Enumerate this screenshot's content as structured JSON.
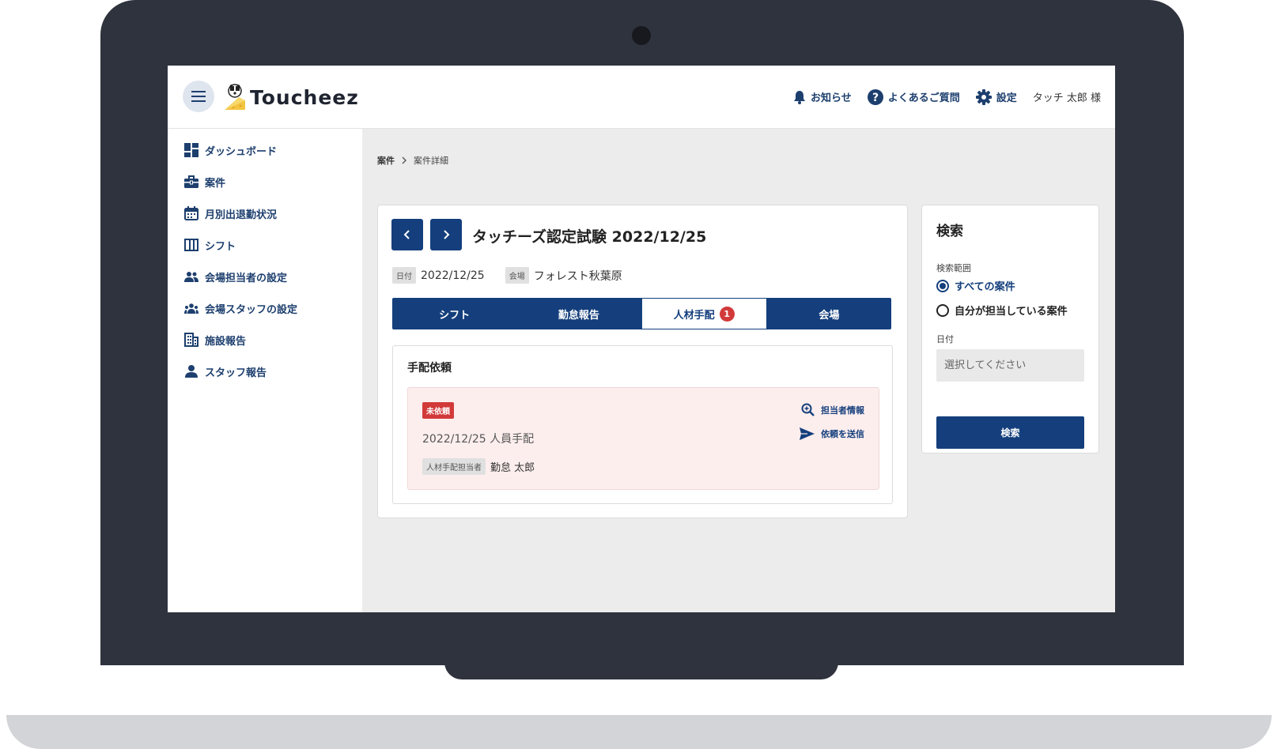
{
  "app": {
    "logo_text": "Toucheez"
  },
  "header": {
    "notice_label": "お知らせ",
    "faq_label": "よくあるご質問",
    "settings_label": "設定",
    "user_label": "タッチ 太郎 様"
  },
  "sidebar": {
    "items": [
      {
        "label": "ダッシュボード",
        "icon": "dashboard-icon"
      },
      {
        "label": "案件",
        "icon": "briefcase-icon"
      },
      {
        "label": "月別出退勤状況",
        "icon": "calendar-icon"
      },
      {
        "label": "シフト",
        "icon": "columns-icon"
      },
      {
        "label": "会場担当者の設定",
        "icon": "people-icon"
      },
      {
        "label": "会場スタッフの設定",
        "icon": "group-icon"
      },
      {
        "label": "施設報告",
        "icon": "building-icon"
      },
      {
        "label": "スタッフ報告",
        "icon": "person-icon"
      }
    ]
  },
  "breadcrumb": {
    "root": "案件",
    "current": "案件詳細"
  },
  "case": {
    "title": "タッチーズ認定試験 2022/12/25",
    "date_tag": "日付",
    "date": "2022/12/25",
    "venue_tag": "会場",
    "venue": "フォレスト秋葉原"
  },
  "tabs": {
    "shift": "シフト",
    "attendance": "勤怠報告",
    "staffing": "人材手配",
    "staffing_badge": "1",
    "venue": "会場",
    "active": "staffing"
  },
  "request": {
    "section_title": "手配依頼",
    "status": "未依頼",
    "date_line": "2022/12/25 人員手配",
    "person_tag": "人材手配担当者",
    "person_name": "勤怠 太郎",
    "action_info": "担当者情報",
    "action_send": "依頼を送信"
  },
  "search": {
    "title": "検索",
    "scope_label": "検索範囲",
    "scope_options": [
      "すべての案件",
      "自分が担当している案件"
    ],
    "scope_selected": "すべての案件",
    "date_label": "日付",
    "date_placeholder": "選択してください",
    "button_label": "検索"
  },
  "colors": {
    "primary": "#143f7c",
    "badge_red": "#d23a3a",
    "request_bg": "#fdeeee",
    "frame": "#2f333d"
  }
}
